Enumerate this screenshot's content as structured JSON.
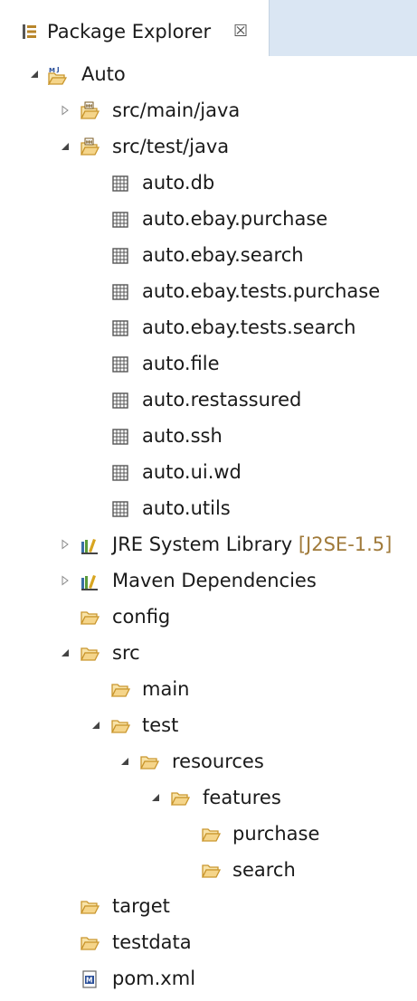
{
  "view": {
    "title": "Package Explorer",
    "close_glyph": "☒"
  },
  "tree": {
    "project": {
      "label": "Auto",
      "expanded": true
    },
    "src_main_java": {
      "label": "src/main/java",
      "expanded": false
    },
    "src_test_java": {
      "label": "src/test/java",
      "expanded": true
    },
    "packages": [
      "auto.db",
      "auto.ebay.purchase",
      "auto.ebay.search",
      "auto.ebay.tests.purchase",
      "auto.ebay.tests.search",
      "auto.file",
      "auto.restassured",
      "auto.ssh",
      "auto.ui.wd",
      "auto.utils"
    ],
    "jre": {
      "label": "JRE System Library",
      "decoration": "[J2SE-1.5]",
      "expanded": false
    },
    "maven": {
      "label": "Maven Dependencies",
      "expanded": false
    },
    "config": {
      "label": "config"
    },
    "src": {
      "label": "src",
      "expanded": true
    },
    "main": {
      "label": "main"
    },
    "test": {
      "label": "test",
      "expanded": true
    },
    "resources": {
      "label": "resources",
      "expanded": true
    },
    "features": {
      "label": "features",
      "expanded": true
    },
    "purchase": {
      "label": "purchase"
    },
    "search": {
      "label": "search"
    },
    "target": {
      "label": "target"
    },
    "testdata": {
      "label": "testdata"
    },
    "pom": {
      "label": "pom.xml"
    }
  },
  "icons": {
    "view_icon": "package-explorer-icon",
    "project_icon": "maven-project-icon",
    "source_folder_icon": "source-folder-icon",
    "package_icon": "package-icon",
    "library_icon": "library-icon",
    "folder_icon": "folder-icon",
    "file_icon": "maven-file-icon",
    "expanded_icon": "expanded-triangle-icon",
    "collapsed_icon": "collapsed-triangle-icon"
  },
  "colors": {
    "tabbar_bg": "#dae6f3",
    "folder_fill": "#f5d58a",
    "folder_stroke": "#c9962d",
    "package_stroke": "#555555",
    "decoration_text": "#a07a3a"
  }
}
